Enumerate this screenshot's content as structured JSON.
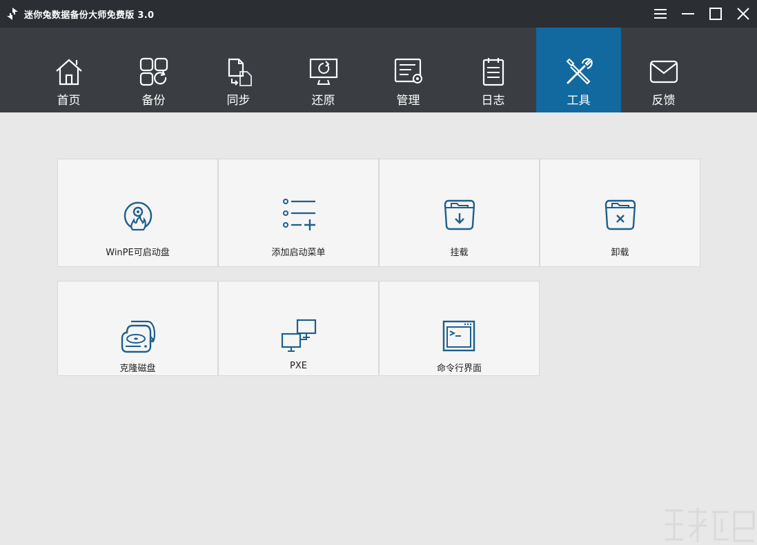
{
  "window": {
    "title": "迷你兔数据备份大师免费版 3.0"
  },
  "nav": {
    "items": [
      {
        "label": "首页",
        "icon": "home-icon"
      },
      {
        "label": "备份",
        "icon": "backup-icon"
      },
      {
        "label": "同步",
        "icon": "sync-icon"
      },
      {
        "label": "还原",
        "icon": "restore-icon"
      },
      {
        "label": "管理",
        "icon": "manage-icon"
      },
      {
        "label": "日志",
        "icon": "log-icon"
      },
      {
        "label": "工具",
        "icon": "tools-icon",
        "active": true
      },
      {
        "label": "反馈",
        "icon": "feedback-icon"
      }
    ]
  },
  "tools": {
    "items": [
      {
        "label": "WinPE可启动盘",
        "icon": "bootable-disc-icon"
      },
      {
        "label": "添加启动菜单",
        "icon": "boot-menu-icon"
      },
      {
        "label": "挂载",
        "icon": "mount-icon"
      },
      {
        "label": "卸载",
        "icon": "unmount-icon"
      },
      {
        "label": "克隆磁盘",
        "icon": "clone-disk-icon"
      },
      {
        "label": "PXE",
        "icon": "pxe-network-icon"
      },
      {
        "label": "命令行界面",
        "icon": "command-line-icon"
      }
    ]
  },
  "colors": {
    "titlebar": "#2b2f33",
    "navbar": "#3a3e42",
    "active_tab": "#1169a0",
    "icon_blue": "#1b5f8c",
    "background": "#e8e8e8",
    "tile": "#f5f5f5"
  }
}
